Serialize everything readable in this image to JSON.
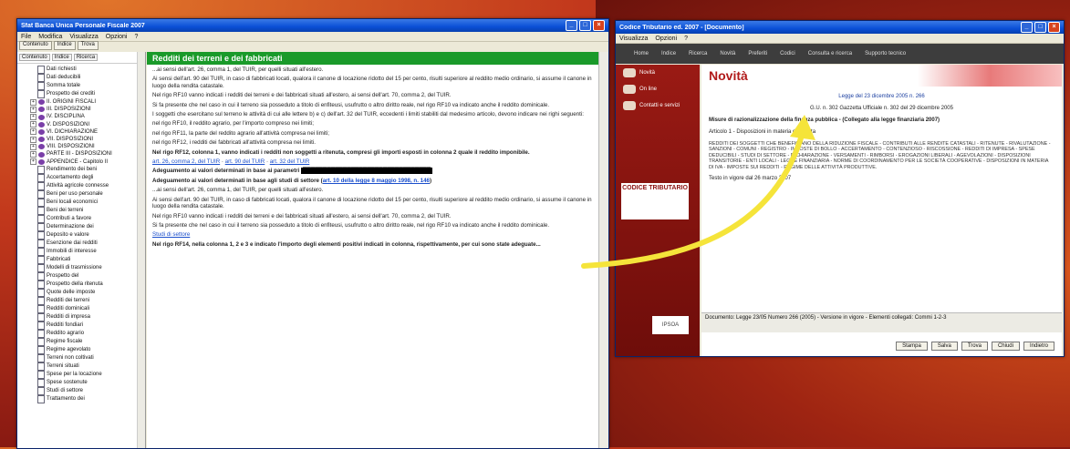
{
  "left_window": {
    "title": "Sfat Banca Unica Personale Fiscale 2007",
    "menu": [
      "File",
      "Modifica",
      "Visualizza",
      "Opzioni",
      "?"
    ],
    "toolbar": [
      "Contenuto",
      "Indice",
      "Trova"
    ],
    "nav_tabs": [
      "Contenuto",
      "Indice",
      "Ricerca"
    ],
    "tree": [
      {
        "label": "Dati richiesti",
        "kind": "doc"
      },
      {
        "label": "Dati deducibili",
        "kind": "doc"
      },
      {
        "label": "Somma totale",
        "kind": "doc"
      },
      {
        "label": "Prospetto dei crediti",
        "kind": "doc"
      },
      {
        "label": "II. ORIGINI FISCALI",
        "kind": "book"
      },
      {
        "label": "III. DISPOSIZIONI",
        "kind": "book"
      },
      {
        "label": "IV. DISCIPLINA",
        "kind": "book"
      },
      {
        "label": "V. DISPOSIZIONI",
        "kind": "book"
      },
      {
        "label": "VI. DICHIARAZIONE",
        "kind": "book"
      },
      {
        "label": "VII. DISPOSIZIONI",
        "kind": "book"
      },
      {
        "label": "VIII. DISPOSIZIONI",
        "kind": "book"
      },
      {
        "label": "PARTE III - DISPOSIZIONI",
        "kind": "book"
      },
      {
        "label": "APPENDICE - Capitolo II",
        "kind": "book"
      },
      {
        "label": "Rendimento dei beni",
        "kind": "doc"
      },
      {
        "label": "Accertamento degli",
        "kind": "doc"
      },
      {
        "label": "Attività agricole connesse",
        "kind": "doc"
      },
      {
        "label": "Beni per uso personale",
        "kind": "doc"
      },
      {
        "label": "Beni locali economici",
        "kind": "doc"
      },
      {
        "label": "Beni dei terreni",
        "kind": "doc"
      },
      {
        "label": "Contributi a favore",
        "kind": "doc"
      },
      {
        "label": "Determinazione dei",
        "kind": "doc"
      },
      {
        "label": "Deposito e valore",
        "kind": "doc"
      },
      {
        "label": "Esenzione dai redditi",
        "kind": "doc"
      },
      {
        "label": "Immobili di interesse",
        "kind": "doc"
      },
      {
        "label": "Fabbricati",
        "kind": "doc"
      },
      {
        "label": "Modelli di trasmissione",
        "kind": "doc"
      },
      {
        "label": "Prospetto del",
        "kind": "doc"
      },
      {
        "label": "Prospetto della ritenuta",
        "kind": "doc"
      },
      {
        "label": "Quote delle imposte",
        "kind": "doc"
      },
      {
        "label": "Redditi dei terreni",
        "kind": "doc"
      },
      {
        "label": "Redditi dominicali",
        "kind": "doc"
      },
      {
        "label": "Redditi di impresa",
        "kind": "doc"
      },
      {
        "label": "Redditi fondiari",
        "kind": "doc"
      },
      {
        "label": "Reddito agrario",
        "kind": "doc"
      },
      {
        "label": "Regime fiscale",
        "kind": "doc"
      },
      {
        "label": "Regime agevolato",
        "kind": "doc"
      },
      {
        "label": "Terreni non coltivati",
        "kind": "doc"
      },
      {
        "label": "Terreni situati",
        "kind": "doc"
      },
      {
        "label": "Spese per la locazione",
        "kind": "doc"
      },
      {
        "label": "Spese sostenute",
        "kind": "doc"
      },
      {
        "label": "Studi di settore",
        "kind": "doc"
      },
      {
        "label": "Trattamento dei",
        "kind": "doc"
      }
    ],
    "page_title": "Redditi dei terreni e dei fabbricati",
    "paragraphs": [
      "...ai sensi dell'art. 26, comma 1, del TUIR, per quelli situati all'estero.",
      "Ai sensi dell'art. 90 del TUIR, in caso di fabbricati locati, qualora il canone di locazione ridotto del 15 per cento, risulti superiore al reddito medio ordinario, si assume il canone in luogo della rendita catastale.",
      "Nel rigo RF10 vanno indicati i redditi dei terreni e dei fabbricati situati all'estero, ai sensi dell'art. 70, comma 2, del TUIR.",
      "Si fa presente che nel caso in cui il terreno sia posseduto a titolo di enfiteusi, usufrutto o altro diritto reale, nel rigo RF10 va indicato anche il reddito dominicale.",
      "I soggetti che esercitano sul terreno le attività di cui alle lettere b) e c) dell'art. 32 del TUIR, eccedenti i limiti stabiliti dal medesimo articolo, devono indicare nei righi seguenti:",
      "nel rigo RF10, il reddito agrario, per l'importo compreso nei limiti;",
      "nel rigo RF11, la parte del reddito agrario all'attività compresa nei limiti;",
      "nel rigo RF12, i redditi dei fabbricati all'attività compresa nei limiti.",
      "Nel rigo RF12, colonna 1, vanno indicati i redditi non soggetti a ritenuta, compresi gli importi esposti in colonna 2 quale il reddito imponibile.",
      "Adeguamento ai valori determinati in base ai parametri",
      "Adeguamento ai valori determinati in base agli studi di settore",
      "Nel rigo RF14, nella colonna 1, 2 e 3 e indicato l'importo degli elementi positivi indicati in colonna, rispettivamente, per cui sono state adeguate..."
    ],
    "links": [
      "art. 26, comma 2, del TUIR",
      "art. 90 del TUIR",
      "art. 32 del TUIR",
      "art. 10 della legge 8 maggio 1998, n. 146",
      "Studi di settore"
    ]
  },
  "right_window": {
    "title": "Codice Tributario ed. 2007 - [Documento]",
    "menu": [
      "Visualizza",
      "Opzioni",
      "?"
    ],
    "top_nav": [
      "Home",
      "Indice",
      "Ricerca",
      "Novità",
      "Preferiti",
      "Codici",
      "Consulta e ricerca",
      "Supporto tecnico"
    ],
    "side_nav": [
      "Novità",
      "On line",
      "Contatti e servizi"
    ],
    "brand": "CODICE TRIBUTARIO",
    "publisher": "IPSOA",
    "section_title": "Novità",
    "law_ref": "Legge del 23 dicembre 2005 n. 266",
    "gazette": "G.U. n. 302 Gazzetta Ufficiale n. 302 del 29 dicembre 2005",
    "law_title": "Misure di razionalizzazione della finanza pubblica - (Collegato alla legge finanziaria 2007)",
    "article": "Articolo 1 - Disposizioni in materia di entrata",
    "article_text": "Redditi dei soggetti che beneficiano della riduzione fiscale - Contributi alle rendite catastali - Ritenute - Rivalutazione - Sanzioni - Comuni - Registro - Imposte di bollo - Accertamento - Contenzioso - Riscossione - Redditi di impresa - Spese deducibili - Studi di settore - Dichiarazione - Versamenti - Rimborsi - Erogazioni liberali - Agevolazioni - Disposizioni transitorie - Enti locali - Legge finanziaria - Norme di coordinamento per le società cooperative - Disposizioni in materia di IVA - Imposte sui redditi - Regime delle attività produttive.",
    "vigore": "Testo in vigore dal 26 marzo 2007",
    "status": "Documento: Legge 23/05 Numero 266 (2005) - Versione in vigore - Elementi collegati: Commi 1-2-3",
    "buttons": [
      "Stampa",
      "Salva",
      "Trova",
      "Chiudi",
      "Indietro"
    ]
  },
  "accent": {
    "arrow": "#f5e43a",
    "header_green": "#1a9a2a",
    "brand_red": "#b11a1a"
  }
}
